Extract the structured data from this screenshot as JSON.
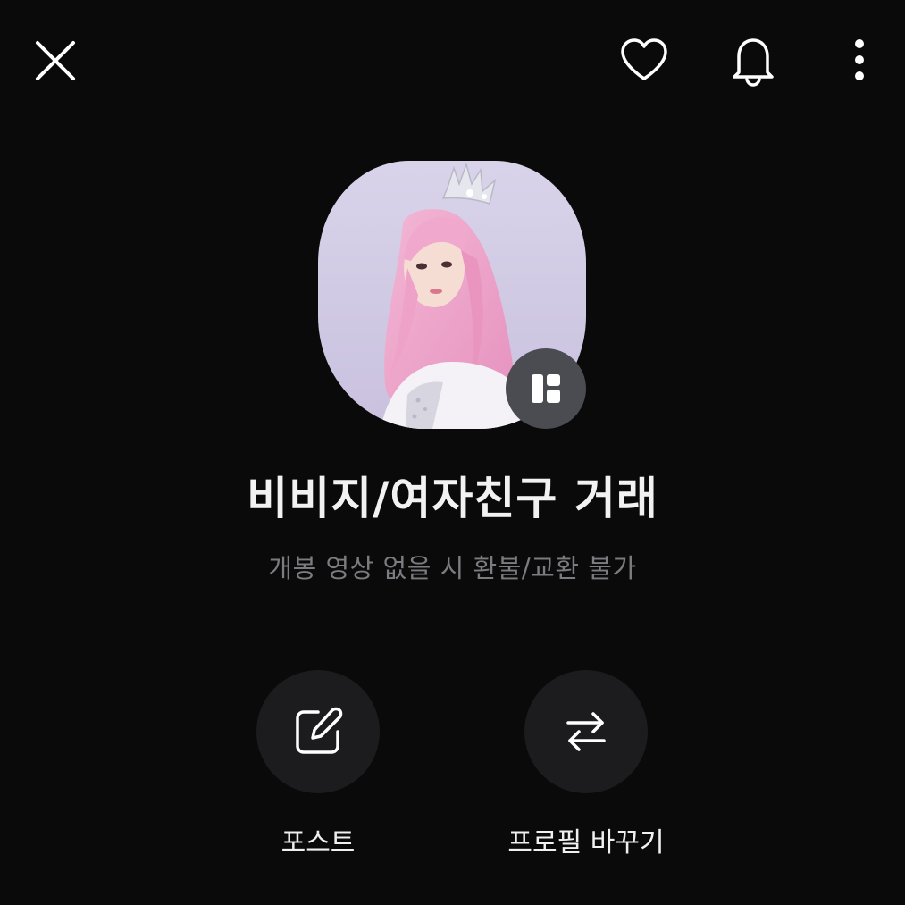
{
  "header": {
    "close_icon": "close-icon",
    "heart_icon": "heart-icon",
    "bell_icon": "bell-icon",
    "more_icon": "more-vertical-icon"
  },
  "profile": {
    "avatar_badge_icon": "layout-grid-icon",
    "name": "비비지/여자친구 거래",
    "status_message": "개봉 영상 없을 시 환불/교환 불가"
  },
  "actions": [
    {
      "label": "포스트",
      "icon": "edit-icon"
    },
    {
      "label": "프로필 바꾸기",
      "icon": "swap-arrows-icon"
    }
  ],
  "colors": {
    "background": "#0a0a0b",
    "title": "#f2f2f2",
    "subtitle": "#7c7c80",
    "action_circle": "#1c1c1e",
    "badge": "#4a4c52"
  }
}
